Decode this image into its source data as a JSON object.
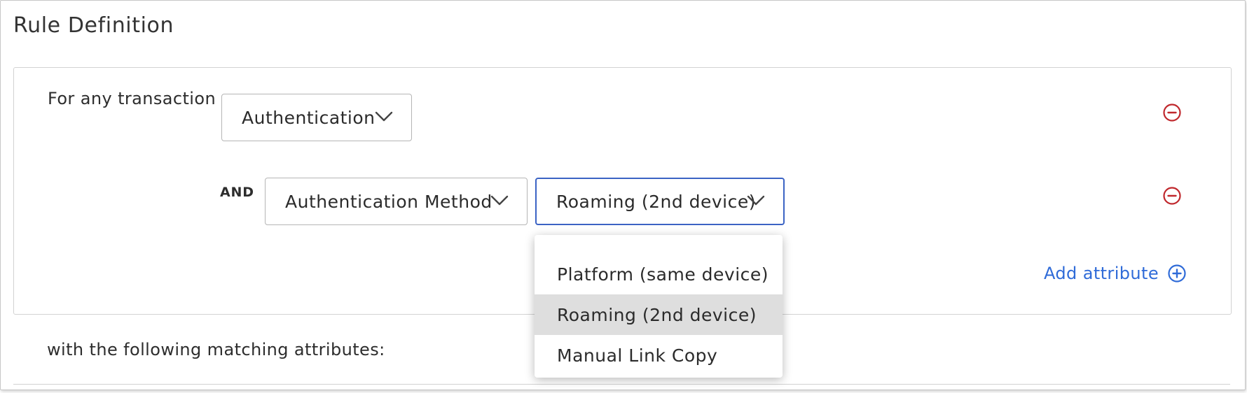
{
  "section": {
    "title": "Rule Definition"
  },
  "rule": {
    "transaction_label": "For any transaction",
    "transaction_select": {
      "value": "Authentication",
      "icon": "chevron-down-icon"
    },
    "and_label": "AND",
    "attribute_select": {
      "value": "Authentication Method",
      "icon": "chevron-down-icon"
    },
    "value_select": {
      "value": "Roaming (2nd device)",
      "icon": "chevron-down-icon"
    },
    "remove_icon": "minus-circle-icon",
    "add_attribute": {
      "label": "Add attribute",
      "icon": "plus-circle-icon"
    }
  },
  "dropdown": {
    "options": [
      "Platform (same device)",
      "Roaming (2nd device)",
      "Manual Link Copy"
    ],
    "selected": "Roaming (2nd device)"
  },
  "matching": {
    "label": "with the following matching attributes:"
  },
  "colors": {
    "accent": "#3b63c4",
    "link": "#2f6bd8",
    "remove": "#c0282d",
    "selected_option_bg": "#dedede"
  }
}
